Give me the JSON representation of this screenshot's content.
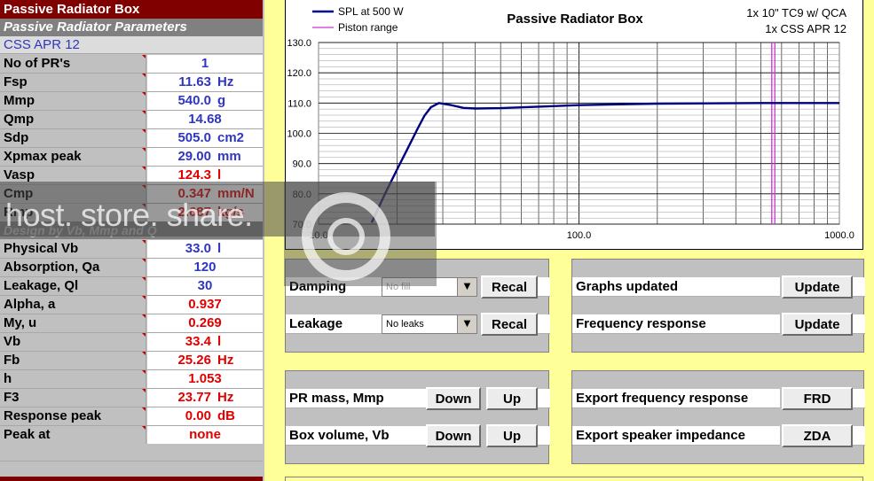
{
  "sheet": {
    "title": "Passive Radiator Box",
    "params_header": "Passive Radiator Parameters",
    "pr_name": "CSS APR 12",
    "design_header": "Design by Vb, Mmp and Q",
    "params": [
      {
        "label": "No of PR's",
        "value": "1",
        "unit": "",
        "color": "blue"
      },
      {
        "label": "Fsp",
        "value": "11.63",
        "unit": "Hz",
        "color": "blue"
      },
      {
        "label": "Mmp",
        "value": "540.0",
        "unit": "g",
        "color": "blue"
      },
      {
        "label": "Qmp",
        "value": "14.68",
        "unit": "",
        "color": "blue"
      },
      {
        "label": "Sdp",
        "value": "505.0",
        "unit": "cm2",
        "color": "blue"
      },
      {
        "label": "Xpmax peak",
        "value": "29.00",
        "unit": "mm",
        "color": "blue"
      },
      {
        "label": "Vasp",
        "value": "124.3",
        "unit": "l",
        "color": "red"
      },
      {
        "label": "Cmp",
        "value": "0.347",
        "unit": "mm/N",
        "color": "red"
      },
      {
        "label": "Rmp",
        "value": "2.687",
        "unit": "kg/s",
        "color": "red"
      }
    ],
    "design": [
      {
        "label": "Physical Vb",
        "value": "33.0",
        "unit": "l",
        "color": "blue"
      },
      {
        "label": "Absorption, Qa",
        "value": "120",
        "unit": "",
        "color": "blue"
      },
      {
        "label": "Leakage, Ql",
        "value": "30",
        "unit": "",
        "color": "blue"
      },
      {
        "label": "Alpha, a",
        "value": "0.937",
        "unit": "",
        "color": "red"
      },
      {
        "label": "My, u",
        "value": "0.269",
        "unit": "",
        "color": "red"
      },
      {
        "label": "Vb",
        "value": "33.4",
        "unit": "l",
        "color": "red"
      },
      {
        "label": "Fb",
        "value": "25.26",
        "unit": "Hz",
        "color": "red"
      },
      {
        "label": "h",
        "value": "1.053",
        "unit": "",
        "color": "red"
      },
      {
        "label": "F3",
        "value": "23.77",
        "unit": "Hz",
        "color": "red"
      },
      {
        "label": "Response peak",
        "value": "0.00",
        "unit": "dB",
        "color": "red"
      },
      {
        "label": "Peak at",
        "value": "none",
        "unit": "",
        "color": "red"
      }
    ]
  },
  "chart": {
    "title": "Passive Radiator Box",
    "note_line1": "1x 10\" TC9 w/ QCA",
    "note_line2": "1x CSS APR 12",
    "legend": [
      {
        "name": "SPL at 500 W",
        "color": "#000080"
      },
      {
        "name": "Piston range",
        "color": "#cc33cc"
      }
    ]
  },
  "chart_data": {
    "type": "line",
    "title": "Passive Radiator Box",
    "xscale": "log",
    "xlim": [
      10,
      1000
    ],
    "ylim": [
      70,
      130
    ],
    "xticks": [
      "10.0",
      "100.0",
      "1000.0"
    ],
    "yticks": [
      "70.0",
      "80.0",
      "90.0",
      "100.0",
      "110.0",
      "120.0",
      "130.0"
    ],
    "grid": true,
    "legend_position": "top-left",
    "series": [
      {
        "name": "SPL at 500 W",
        "color": "#000080",
        "x": [
          16,
          18,
          20,
          22,
          24,
          25.5,
          27,
          29,
          32,
          36,
          40,
          50,
          70,
          100,
          150,
          200,
          300,
          500,
          700,
          1000
        ],
        "y": [
          70.5,
          80.0,
          88.0,
          95.0,
          101.5,
          105.8,
          108.6,
          110.0,
          109.4,
          108.4,
          108.2,
          108.3,
          108.8,
          109.3,
          109.6,
          109.8,
          109.9,
          110.0,
          110.0,
          110.0
        ]
      }
    ],
    "markers": [
      {
        "name": "Piston range",
        "color": "#cc33cc",
        "x": [
          550,
          565
        ]
      }
    ]
  },
  "controls": {
    "damping_label": "Damping",
    "damping_value": "No fill",
    "leakage_label": "Leakage",
    "leakage_value": "No leaks",
    "recal_label": "Recal",
    "graphs_label": "Graphs updated",
    "freq_label": "Frequency response",
    "update_label": "Update",
    "pr_mass_label": "PR mass, Mmp",
    "box_volume_label": "Box volume, Vb",
    "down_label": "Down",
    "up_label": "Up",
    "export_fr_label": "Export frequency response",
    "export_imp_label": "Export speaker impedance",
    "frd_label": "FRD",
    "zda_label": "ZDA"
  },
  "watermark": {
    "text": "host. store. share."
  }
}
